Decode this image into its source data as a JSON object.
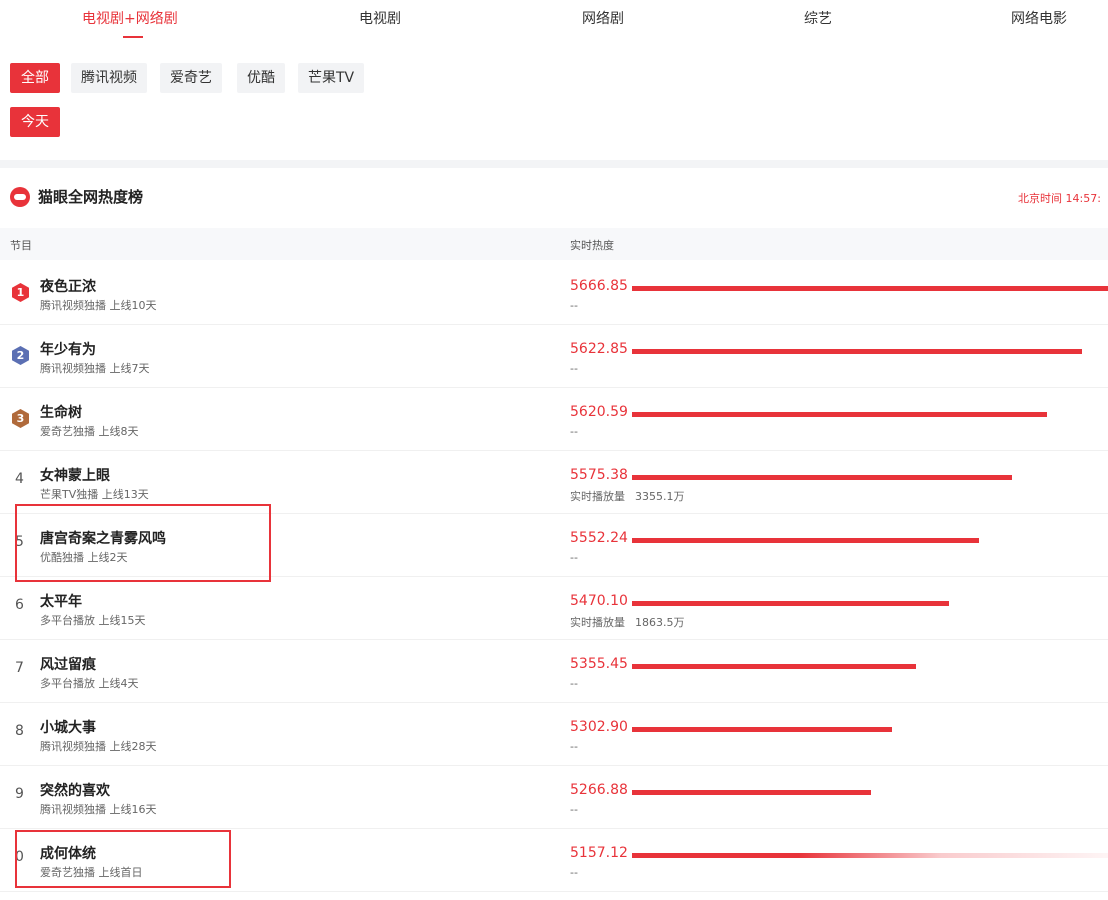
{
  "tabs": [
    {
      "label": "电视剧+网络剧",
      "active": true
    },
    {
      "label": "电视剧",
      "active": false
    },
    {
      "label": "网络剧",
      "active": false
    },
    {
      "label": "综艺",
      "active": false
    },
    {
      "label": "网络电影",
      "active": false
    }
  ],
  "platform_filters": [
    {
      "label": "全部",
      "active": true
    },
    {
      "label": "腾讯视频",
      "active": false
    },
    {
      "label": "爱奇艺",
      "active": false
    },
    {
      "label": "优酷",
      "active": false
    },
    {
      "label": "芒果TV",
      "active": false
    }
  ],
  "date_filter": {
    "label": "今天",
    "active": true
  },
  "section": {
    "title": "猫眼全网热度榜",
    "update_time": "北京时间 14:57:"
  },
  "table": {
    "headers": {
      "program": "节目",
      "heat": "实时热度"
    }
  },
  "accent_color": "#e8333a",
  "rows": [
    {
      "rank": "1",
      "title": "夜色正浓",
      "sub": "腾讯视频独播 上线10天",
      "heat": "5666.85",
      "heat_sub": "--",
      "bar_fraction": 1.0
    },
    {
      "rank": "2",
      "title": "年少有为",
      "sub": "腾讯视频独播 上线7天",
      "heat": "5622.85",
      "heat_sub": "--",
      "bar_fraction": 0.945
    },
    {
      "rank": "3",
      "title": "生命树",
      "sub": "爱奇艺独播 上线8天",
      "heat": "5620.59",
      "heat_sub": "--",
      "bar_fraction": 0.871
    },
    {
      "rank": "4",
      "title": "女神蒙上眼",
      "sub": "芒果TV独播 上线13天",
      "heat": "5575.38",
      "heat_sub": "实时播放量",
      "heat_sub_value": "3355.1万",
      "bar_fraction": 0.798
    },
    {
      "rank": "5",
      "title": "唐宫奇案之青雾风鸣",
      "sub": "优酷独播 上线2天",
      "heat": "5552.24",
      "heat_sub": "--",
      "bar_fraction": 0.73
    },
    {
      "rank": "6",
      "title": "太平年",
      "sub": "多平台播放 上线15天",
      "heat": "5470.10",
      "heat_sub": "实时播放量",
      "heat_sub_value": "1863.5万",
      "bar_fraction": 0.666
    },
    {
      "rank": "7",
      "title": "风过留痕",
      "sub": "多平台播放 上线4天",
      "heat": "5355.45",
      "heat_sub": "--",
      "bar_fraction": 0.597
    },
    {
      "rank": "8",
      "title": "小城大事",
      "sub": "腾讯视频独播 上线28天",
      "heat": "5302.90",
      "heat_sub": "--",
      "bar_fraction": 0.546
    },
    {
      "rank": "9",
      "title": "突然的喜欢",
      "sub": "腾讯视频独播 上线16天",
      "heat": "5266.88",
      "heat_sub": "--",
      "bar_fraction": 0.502
    },
    {
      "rank": "0",
      "title": "成何体统",
      "sub": "爱奇艺独播 上线首日",
      "heat": "5157.12",
      "heat_sub": "--",
      "bar_fraction": 0.4
    }
  ]
}
